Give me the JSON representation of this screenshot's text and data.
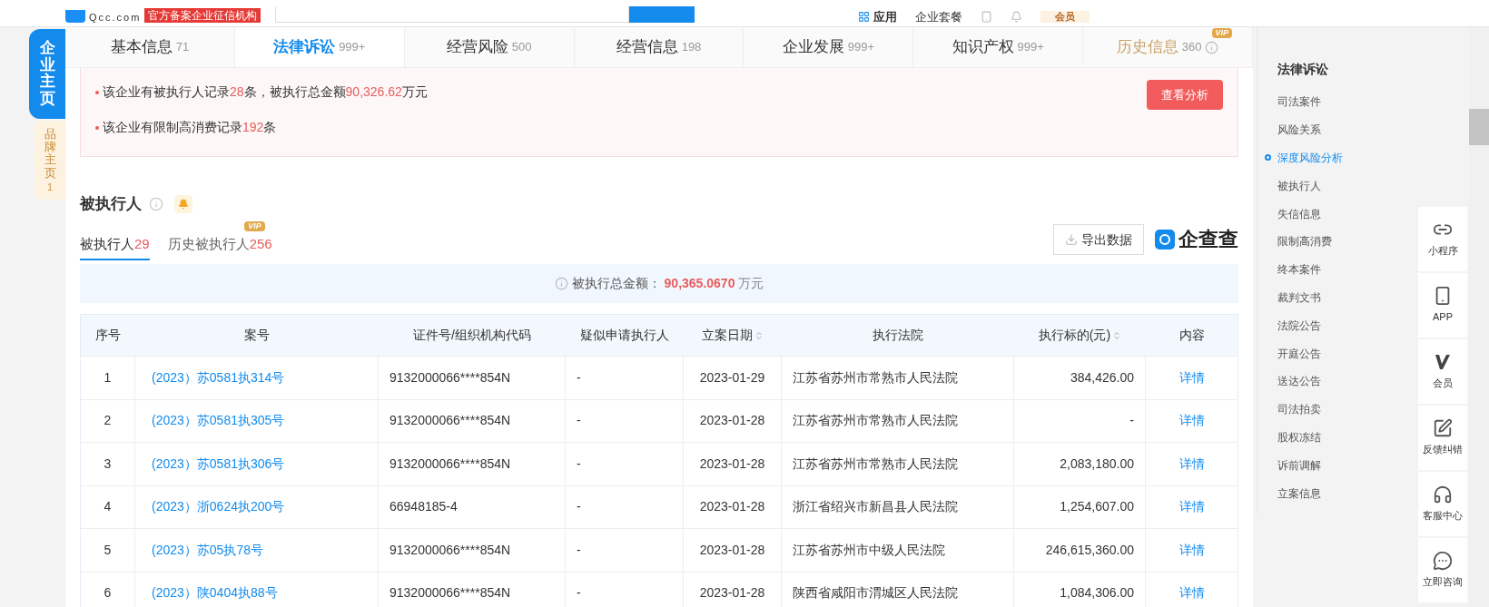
{
  "header": {
    "logo_domain": "Qcc.com",
    "badge": "官方备案企业征信机构",
    "nav": [
      "应用",
      "企业套餐"
    ],
    "vip_label": "会员"
  },
  "side_tabs": [
    {
      "label": "企业主页",
      "selected": true
    },
    {
      "label": "品牌主页",
      "count": "1",
      "selected": false
    }
  ],
  "tabs": [
    {
      "label": "基本信息",
      "count": "71",
      "selected": false,
      "kind": "normal"
    },
    {
      "label": "法律诉讼",
      "count": "999+",
      "selected": true,
      "kind": "normal"
    },
    {
      "label": "经营风险",
      "count": "500",
      "selected": false,
      "kind": "normal"
    },
    {
      "label": "经营信息",
      "count": "198",
      "selected": false,
      "kind": "normal"
    },
    {
      "label": "企业发展",
      "count": "999+",
      "selected": false,
      "kind": "normal"
    },
    {
      "label": "知识产权",
      "count": "999+",
      "selected": false,
      "kind": "normal"
    },
    {
      "label": "历史信息",
      "count": "360",
      "selected": false,
      "kind": "vip",
      "badge": "VIP"
    }
  ],
  "alert": {
    "lines": [
      [
        {
          "text": "该企业有被执行人记录",
          "highlight": false
        },
        {
          "text": "28",
          "highlight": true
        },
        {
          "text": "条，被执行总金额",
          "highlight": false
        },
        {
          "text": "90,326.62",
          "highlight": true
        },
        {
          "text": "万元",
          "highlight": false
        }
      ],
      [
        {
          "text": "该企业有限制高消费记录",
          "highlight": false
        },
        {
          "text": "192",
          "highlight": true
        },
        {
          "text": "条",
          "highlight": false
        }
      ]
    ],
    "button": "查看分析"
  },
  "section": {
    "title": "被执行人",
    "subtabs": [
      {
        "label": "被执行人",
        "count": "29",
        "selected": true
      },
      {
        "label": "历史被执行人",
        "count": "256",
        "selected": false,
        "badge": "VIP"
      }
    ],
    "export_button": "导出数据",
    "brand": "企查查",
    "total_label": "被执行总金额：",
    "total_value": "90,365.0670",
    "total_unit": "万元"
  },
  "table": {
    "columns": [
      {
        "label": "序号",
        "sortable": false
      },
      {
        "label": "案号",
        "sortable": false
      },
      {
        "label": "证件号/组织机构代码",
        "sortable": false
      },
      {
        "label": "疑似申请执行人",
        "sortable": false
      },
      {
        "label": "立案日期",
        "sortable": true
      },
      {
        "label": "执行法院",
        "sortable": false
      },
      {
        "label": "执行标的(元)",
        "sortable": true
      },
      {
        "label": "内容",
        "sortable": false
      }
    ],
    "rows": [
      [
        "1",
        "(2023）苏0581执314号",
        "9132000066****854N",
        "-",
        "2023-01-29",
        "江苏省苏州市常熟市人民法院",
        "384,426.00",
        "详情"
      ],
      [
        "2",
        "(2023）苏0581执305号",
        "9132000066****854N",
        "-",
        "2023-01-28",
        "江苏省苏州市常熟市人民法院",
        "-",
        "详情"
      ],
      [
        "3",
        "(2023）苏0581执306号",
        "9132000066****854N",
        "-",
        "2023-01-28",
        "江苏省苏州市常熟市人民法院",
        "2,083,180.00",
        "详情"
      ],
      [
        "4",
        "(2023）浙0624执200号",
        "66948185-4",
        "-",
        "2023-01-28",
        "浙江省绍兴市新昌县人民法院",
        "1,254,607.00",
        "详情"
      ],
      [
        "5",
        "(2023）苏05执78号",
        "9132000066****854N",
        "-",
        "2023-01-28",
        "江苏省苏州市中级人民法院",
        "246,615,360.00",
        "详情"
      ],
      [
        "6",
        "(2023）陕0404执88号",
        "9132000066****854N",
        "-",
        "2023-01-28",
        "陕西省咸阳市渭城区人民法院",
        "1,084,306.00",
        "详情"
      ]
    ]
  },
  "right_nav": {
    "title": "法律诉讼",
    "items": [
      {
        "label": "司法案件",
        "selected": false
      },
      {
        "label": "风险关系",
        "selected": false
      },
      {
        "label": "深度风险分析",
        "selected": true
      },
      {
        "label": "被执行人",
        "selected": false
      },
      {
        "label": "失信信息",
        "selected": false
      },
      {
        "label": "限制高消费",
        "selected": false
      },
      {
        "label": "终本案件",
        "selected": false
      },
      {
        "label": "裁判文书",
        "selected": false
      },
      {
        "label": "法院公告",
        "selected": false
      },
      {
        "label": "开庭公告",
        "selected": false
      },
      {
        "label": "送达公告",
        "selected": false
      },
      {
        "label": "司法拍卖",
        "selected": false
      },
      {
        "label": "股权冻结",
        "selected": false
      },
      {
        "label": "诉前调解",
        "selected": false
      },
      {
        "label": "立案信息",
        "selected": false
      }
    ]
  },
  "float_toolbar": [
    {
      "label": "小程序",
      "kind": "link"
    },
    {
      "label": "APP",
      "kind": "phone"
    },
    {
      "label": "会员",
      "kind": "vip"
    },
    {
      "label": "反馈纠错",
      "kind": "edit"
    },
    {
      "label": "客服中心",
      "kind": "headset"
    },
    {
      "label": "立即咨询",
      "kind": "chat"
    }
  ]
}
